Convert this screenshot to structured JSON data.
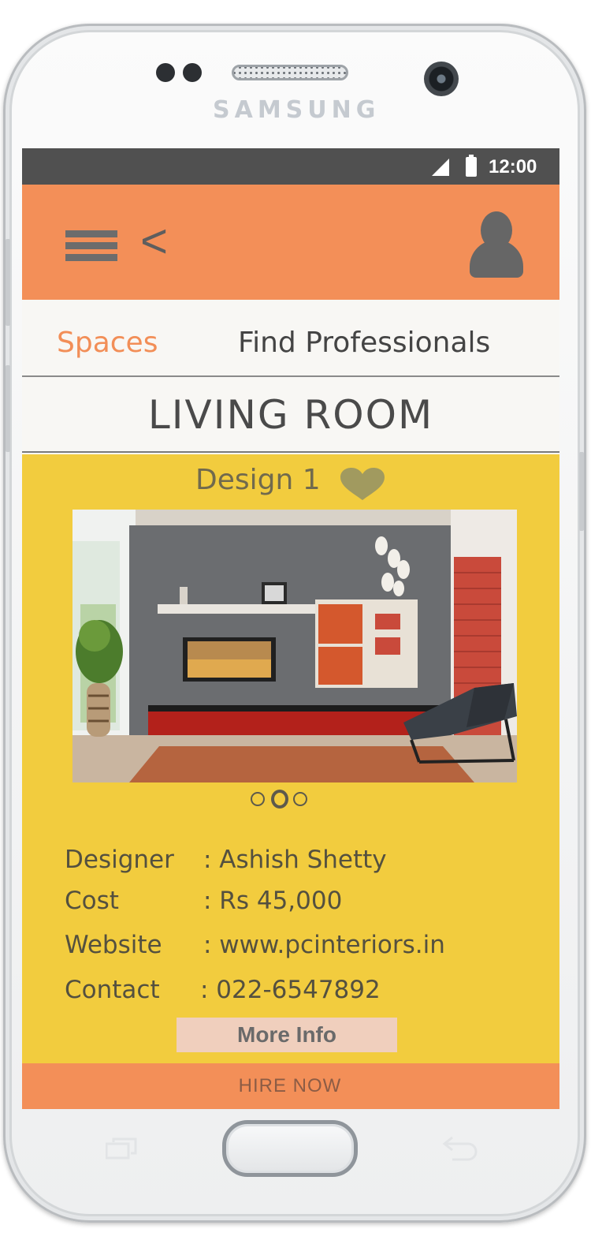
{
  "device": {
    "brand": "SAMSUNG"
  },
  "status_bar": {
    "time": "12:00"
  },
  "app_bar": {
    "menu_icon": "hamburger-icon",
    "back_icon": "chevron-left-icon",
    "back_glyph": "<",
    "profile_icon": "user-icon"
  },
  "tabs": [
    {
      "label": "Spaces",
      "active": true
    },
    {
      "label": "Find Professionals",
      "active": false
    }
  ],
  "page": {
    "title": "LIVING ROOM"
  },
  "design": {
    "label": "Design 1",
    "favorite_icon": "heart-icon",
    "carousel": {
      "count": 3,
      "active_index": 1
    }
  },
  "details": [
    {
      "key": "Designer",
      "value": ": Ashish Shetty"
    },
    {
      "key": "Cost",
      "value": ": Rs 45,000"
    },
    {
      "key": "Website",
      "value": ": www.pcinteriors.in"
    },
    {
      "key": "Contact",
      "value": ": 022-6547892"
    }
  ],
  "actions": {
    "more_info": "More Info",
    "hire_now": "HIRE NOW"
  },
  "colors": {
    "accent": "#f38f58",
    "content_bg": "#f2cc3e",
    "status_bar": "#505050",
    "more_info_bg": "#f0cfbd"
  }
}
